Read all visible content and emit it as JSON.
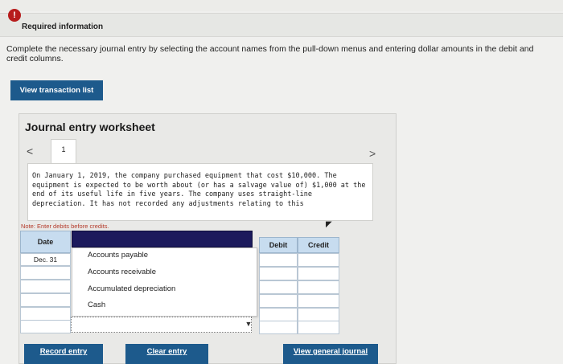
{
  "header": {
    "required_info": "Required information"
  },
  "instructions": "Complete the necessary journal entry by selecting the account names from the pull-down menus and entering dollar amounts in the debit and credit columns.",
  "buttons": {
    "view_transaction_list": "View transaction list",
    "record_entry": "Record entry",
    "clear_entry": "Clear entry",
    "view_general_journal": "View general journal"
  },
  "worksheet": {
    "title": "Journal entry worksheet",
    "page_number": "1",
    "scenario": "On January 1, 2019, the company purchased equipment that cost $10,000. The equipment is expected to be worth about (or has a salvage value of) $1,000 at the end of its useful life in five years. The company uses straight-line depreciation. It has not recorded any adjustments relating to this",
    "note": "Note: Enter debits before credits."
  },
  "table": {
    "headers": {
      "date": "Date",
      "debit": "Debit",
      "credit": "Credit"
    },
    "date_value": "Dec. 31"
  },
  "dropdown": {
    "options": [
      "Accounts payable",
      "Accounts receivable",
      "Accumulated depreciation",
      "Cash"
    ]
  },
  "colors": {
    "button_blue": "#1d5a8c",
    "header_blue": "#c7dcef",
    "dropdown_navy": "#1c1a5c",
    "note_red": "#b43a2a",
    "alert_red": "#b71c1c"
  }
}
